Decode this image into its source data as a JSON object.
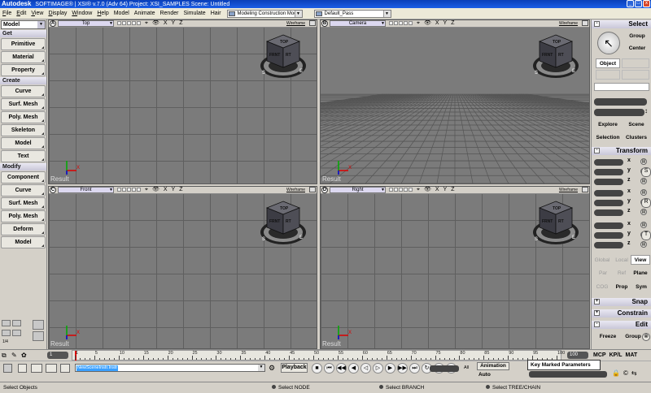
{
  "titlebar": {
    "brand": "Autodesk",
    "text": "SOFTIMAGE® | XSI® v.7.0 (Adv 64) Project: XSI_SAMPLES    Scene: Untitled",
    "minimize": "_",
    "maximize": "□",
    "close": "x"
  },
  "menubar": {
    "items": [
      "File",
      "Edit",
      "View",
      "Display",
      "Window",
      "Help",
      "Model",
      "Animate",
      "Render",
      "Simulate",
      "Hair"
    ],
    "mode_combo": "Modeling Construction Mode",
    "pass_combo": "Default_Pass"
  },
  "left_palette": {
    "module": "Model",
    "sections": [
      {
        "title": "Get",
        "buttons": [
          "Primitive",
          "Material",
          "Property"
        ]
      },
      {
        "title": "Create",
        "buttons": [
          "Curve",
          "Surf. Mesh",
          "Poly. Mesh",
          "Skeleton",
          "Model",
          "Text"
        ]
      },
      {
        "title": "Modify",
        "buttons": [
          "Component",
          "Curve",
          "Surf. Mesh",
          "Poly. Mesh",
          "Deform",
          "Model"
        ]
      }
    ],
    "layout_labels": [
      "1",
      "1/4",
      "0",
      "3"
    ]
  },
  "viewports": [
    {
      "letter": "A",
      "camera": "Top",
      "mode": "Wireframe",
      "result": "Result",
      "perspective": false
    },
    {
      "letter": "B",
      "camera": "Camera",
      "mode": "Wireframe",
      "result": "Result",
      "perspective": true
    },
    {
      "letter": "C",
      "camera": "Front",
      "mode": "Wireframe",
      "result": "Result",
      "perspective": false
    },
    {
      "letter": "D",
      "camera": "Right",
      "mode": "Wireframe",
      "result": "Result",
      "perspective": false
    }
  ],
  "viewport_icons": {
    "eye": "👁",
    "x": "X",
    "y": "Y",
    "z": "Z"
  },
  "right_panel": {
    "select_title": "Select",
    "select_buttons": {
      "group": "Group",
      "center": "Center",
      "object": "Object"
    },
    "explore": "Explore",
    "scene": "Scene",
    "selection": "Selection",
    "clusters": "Clusters",
    "transform_title": "Transform",
    "axes": [
      "x",
      "y",
      "z"
    ],
    "ref": {
      "global": "Global",
      "local": "Local",
      "view": "View",
      "par": "Par",
      "ref": "Ref",
      "plane": "Plane",
      "cog": "COG",
      "prop": "Prop",
      "sym": "Sym"
    },
    "snap_title": "Snap",
    "constrain_title": "Constrain",
    "edit_title": "Edit",
    "freeze": "Freeze",
    "group": "Group",
    "sry": [
      "S",
      "R",
      "T"
    ]
  },
  "timeline": {
    "start": "1",
    "end": "100",
    "ticks": [
      1,
      5,
      10,
      15,
      20,
      25,
      30,
      35,
      40,
      45,
      50,
      55,
      60,
      65,
      70,
      75,
      80,
      85,
      90,
      95,
      100
    ],
    "right": [
      "MCP",
      "KP/L",
      "MAT"
    ]
  },
  "playback": {
    "preset": "NewSceneInstr.Instr",
    "playback_label": "Playback",
    "all": "All",
    "animation": "Animation",
    "auto": "Auto",
    "key_hint": "Key Marked Parameters"
  },
  "status": {
    "left": "Select Objects",
    "s1": "Select NODE",
    "s2": "Select BRANCH",
    "s3": "Select TREE/CHAIN"
  },
  "colors": {
    "viewport_bg": "#7b7b7b",
    "title_bar": "#1b5ee6",
    "timeline_cursor": "#dd0000"
  }
}
